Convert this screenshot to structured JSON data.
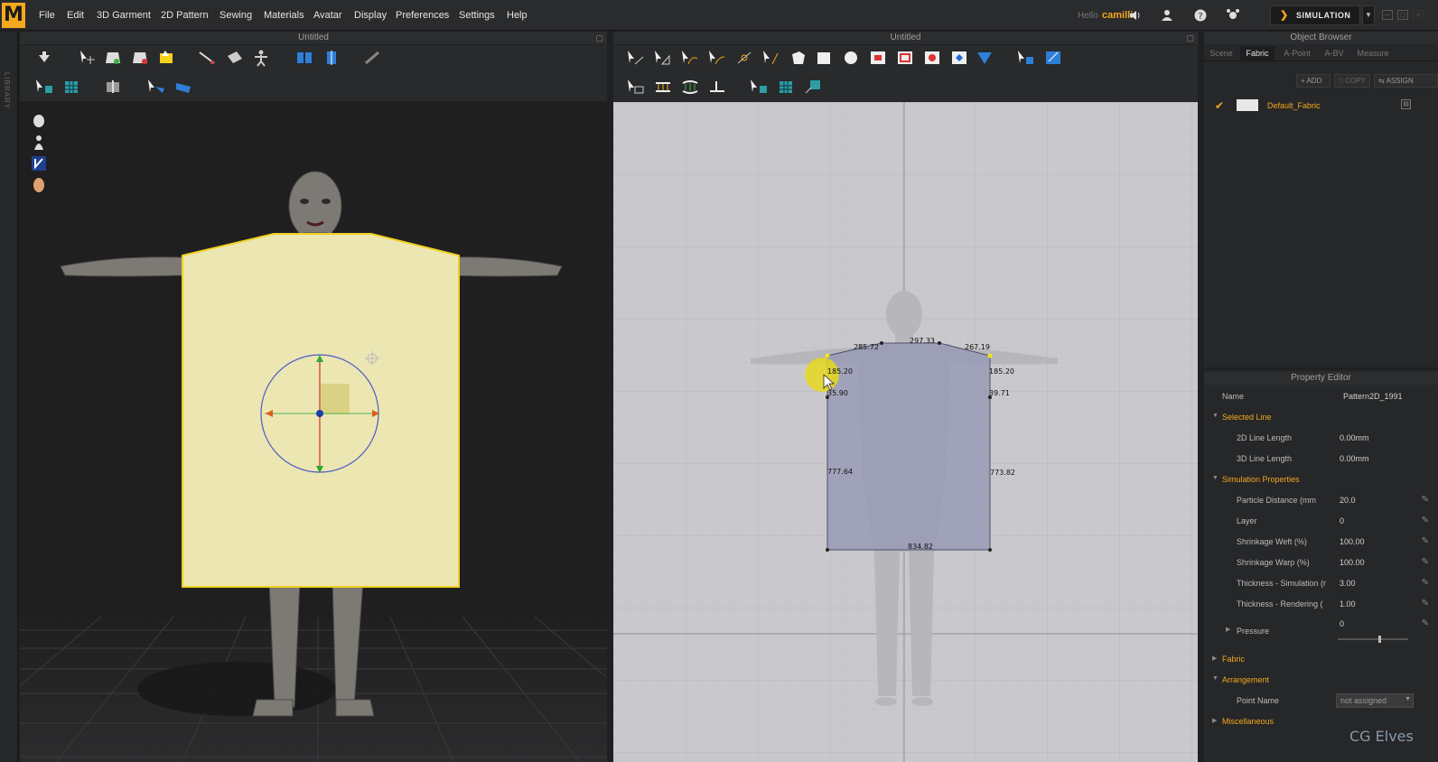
{
  "app": {
    "logo_letter": "M"
  },
  "menu": [
    "File",
    "Edit",
    "3D Garment",
    "2D Pattern",
    "Sewing",
    "Materials",
    "Avatar",
    "Display",
    "Preferences",
    "Settings",
    "Help"
  ],
  "user": {
    "greeting": "Hello",
    "name": "camilli"
  },
  "mode_button": "SIMULATION",
  "library_label": "LIBRARY",
  "panels": {
    "left_title": "Untitled",
    "center_title": "Untitled"
  },
  "pattern_measurements": {
    "top_center": "297.33",
    "top_left": "285.72",
    "top_right": "267.19",
    "shoulder_left": "185.20",
    "shoulder_right": "185.20",
    "armhole_left": "35.90",
    "armhole_right": "39.71",
    "side_left": "777.64",
    "side_right": "773.82",
    "bottom": "834.82"
  },
  "object_browser": {
    "title": "Object Browser",
    "tabs": [
      "Scene",
      "Fabric",
      "A-Point",
      "A-BV",
      "Measure"
    ],
    "active_tab": "Fabric",
    "buttons": {
      "add": "ADD",
      "copy": "COPY",
      "assign": "ASSIGN"
    },
    "fabric_name": "Default_Fabric"
  },
  "property_editor": {
    "title": "Property Editor",
    "name_label": "Name",
    "name_value": "Pattern2D_1991",
    "selected_line": {
      "header": "Selected Line",
      "rows": [
        {
          "label": "2D Line Length",
          "value": "0.00mm"
        },
        {
          "label": "3D Line Length",
          "value": "0.00mm"
        }
      ]
    },
    "simulation": {
      "header": "Simulation Properties",
      "rows": [
        {
          "label": "Particle Distance (mm",
          "value": "20.0"
        },
        {
          "label": "Layer",
          "value": "0"
        },
        {
          "label": "Shrinkage Weft (%)",
          "value": "100.00"
        },
        {
          "label": "Shrinkage Warp (%)",
          "value": "100.00"
        },
        {
          "label": "Thickness - Simulation (r",
          "value": "3.00"
        },
        {
          "label": "Thickness - Rendering (",
          "value": "1.00"
        }
      ],
      "pressure_label": "Pressure",
      "pressure_value": "0",
      "pressure_level": 0.6
    },
    "fabric_header": "Fabric",
    "arrangement": {
      "header": "Arrangement",
      "point_name_label": "Point Name",
      "point_name_value": "not assigned"
    },
    "misc_header": "Miscellaneous"
  },
  "watermark": "CG Elves",
  "colors": {
    "accent": "#f4a81d",
    "garment": "#ece6b2",
    "pattern": "#9a9cb6"
  }
}
